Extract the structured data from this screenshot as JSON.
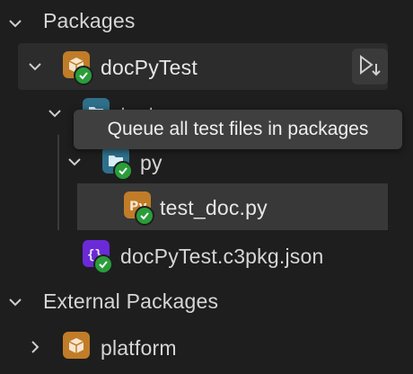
{
  "tree": {
    "packages_header": "Packages",
    "doc_py_test": "docPyTest",
    "test_folder": "test",
    "py_folder": "py",
    "test_doc_file": "test_doc.py",
    "pkg_json_file": "docPyTest.c3pkg.json",
    "external_header": "External Packages",
    "platform": "platform"
  },
  "tooltip": {
    "text": "Queue all test files in packages"
  },
  "colors": {
    "package_icon": "#c07c28",
    "folder_icon": "#2f6f8a",
    "json_icon": "#6a2ad8",
    "status_ok": "#2a9d3a",
    "selected_row": "#2c2c2c",
    "selected_row_active": "#383838"
  },
  "icons": {
    "expand": "chevron-down-icon",
    "collapse": "chevron-right-icon",
    "run": "run-tests-icon"
  }
}
